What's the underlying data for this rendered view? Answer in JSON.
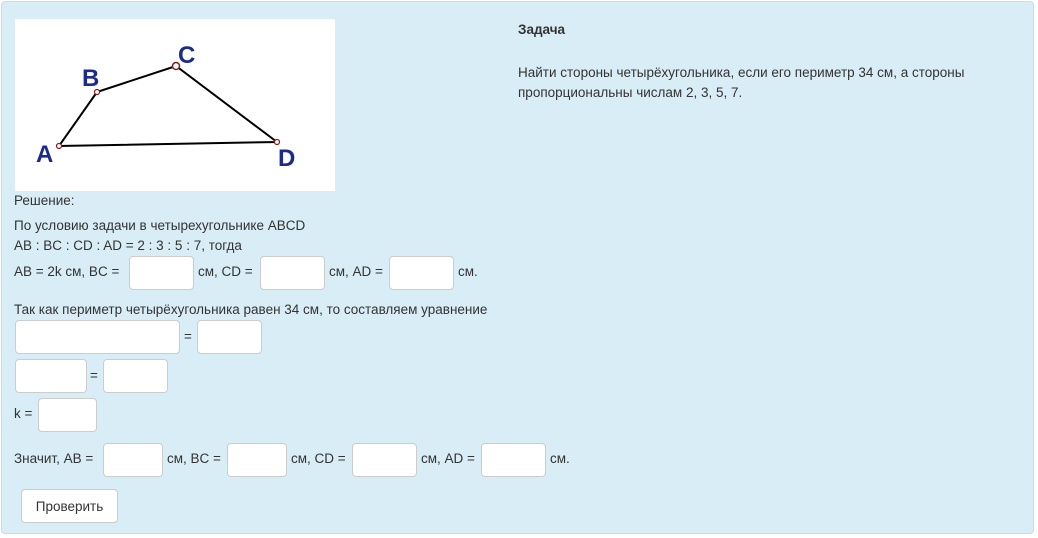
{
  "task": {
    "title": "Задача",
    "text": "Найти стороны четырёхугольника, если его периметр 34 см, а стороны пропорциональны числам 2, 3, 5, 7."
  },
  "figure": {
    "labels": {
      "A": "A",
      "B": "B",
      "C": "C",
      "D": "D"
    },
    "colors": {
      "label": "#1c2a8c",
      "line": "#000000",
      "point": "#8b1a1a"
    }
  },
  "solution": {
    "heading": "Решение:",
    "line1": "По условию задачи в четырехугольнике ABCD",
    "line2": "AB : BC : CD : AD = 2 : 3 : 5 : 7, тогда",
    "row1": {
      "ab_prefix": "AB = 2k см, BC =",
      "bc_value": "",
      "cd_prefix": "см, CD =",
      "cd_value": "",
      "ad_prefix": "см, AD =",
      "ad_value": "",
      "suffix": "см."
    },
    "perimeter_text": "Так как периметр четырёхугольника равен 34 см, то составляем уравнение",
    "eq1": {
      "left": "",
      "sign": "=",
      "right": ""
    },
    "eq2": {
      "left": "",
      "sign": "=",
      "right": ""
    },
    "k": {
      "label": "k =",
      "value": ""
    },
    "answer": {
      "prefix": "Значит, AB =",
      "ab_value": "",
      "bc_prefix": "см, BC =",
      "bc_value": "",
      "cd_prefix": "см, CD =",
      "cd_value": "",
      "ad_prefix": "см, AD =",
      "ad_value": "",
      "suffix": "см."
    }
  },
  "check_button": "Проверить"
}
